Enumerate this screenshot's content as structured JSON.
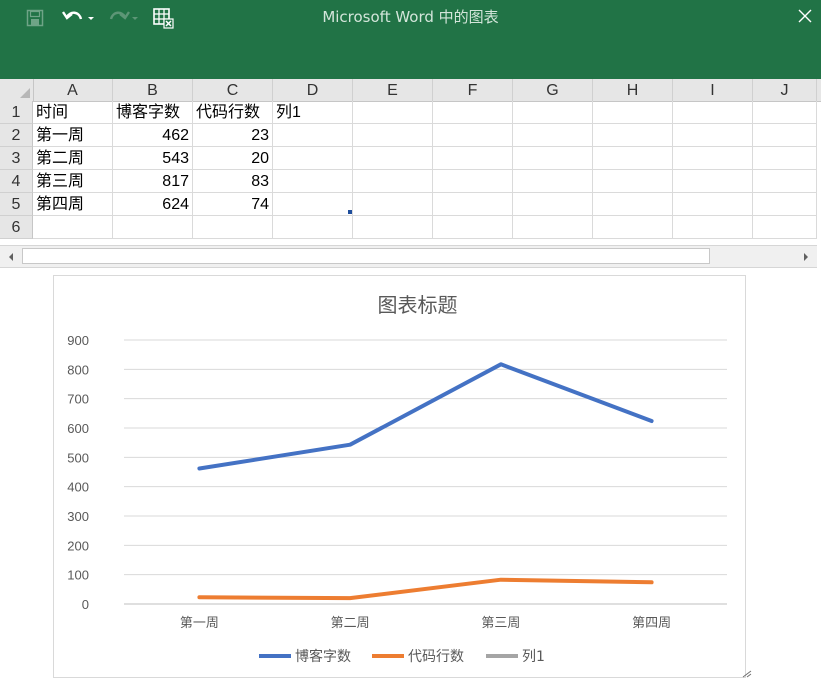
{
  "window": {
    "title": "Microsoft Word 中的图表",
    "colors": {
      "titlebar": "#217346",
      "title_text": "#d3e5da"
    },
    "qat": [
      {
        "name": "save-icon"
      },
      {
        "name": "undo-icon"
      },
      {
        "name": "redo-icon"
      },
      {
        "name": "edit-data-in-excel-icon"
      }
    ],
    "close_icon": "close-icon"
  },
  "sheet": {
    "columns": [
      "A",
      "B",
      "C",
      "D",
      "E",
      "F",
      "G",
      "H",
      "I",
      "J"
    ],
    "rows": [
      "1",
      "2",
      "3",
      "4",
      "5",
      "6"
    ],
    "cells": [
      [
        "时间",
        "博客字数",
        "代码行数",
        "列1"
      ],
      [
        "第一周",
        "462",
        "23",
        ""
      ],
      [
        "第二周",
        "543",
        "20",
        ""
      ],
      [
        "第三周",
        "817",
        "83",
        ""
      ],
      [
        "第四周",
        "624",
        "74",
        ""
      ]
    ]
  },
  "chart_data": {
    "type": "line",
    "title": "图表标题",
    "categories": [
      "第一周",
      "第二周",
      "第三周",
      "第四周"
    ],
    "series": [
      {
        "name": "博客字数",
        "values": [
          462,
          543,
          817,
          624
        ],
        "color": "#4472c4"
      },
      {
        "name": "代码行数",
        "values": [
          23,
          20,
          83,
          74
        ],
        "color": "#ed7d31"
      },
      {
        "name": "列1",
        "values": [],
        "color": "#a5a5a5"
      }
    ],
    "yticks": [
      "0",
      "100",
      "200",
      "300",
      "400",
      "500",
      "600",
      "700",
      "800",
      "900"
    ],
    "ylim": [
      0,
      900
    ],
    "grid": true,
    "legend_position": "bottom"
  }
}
